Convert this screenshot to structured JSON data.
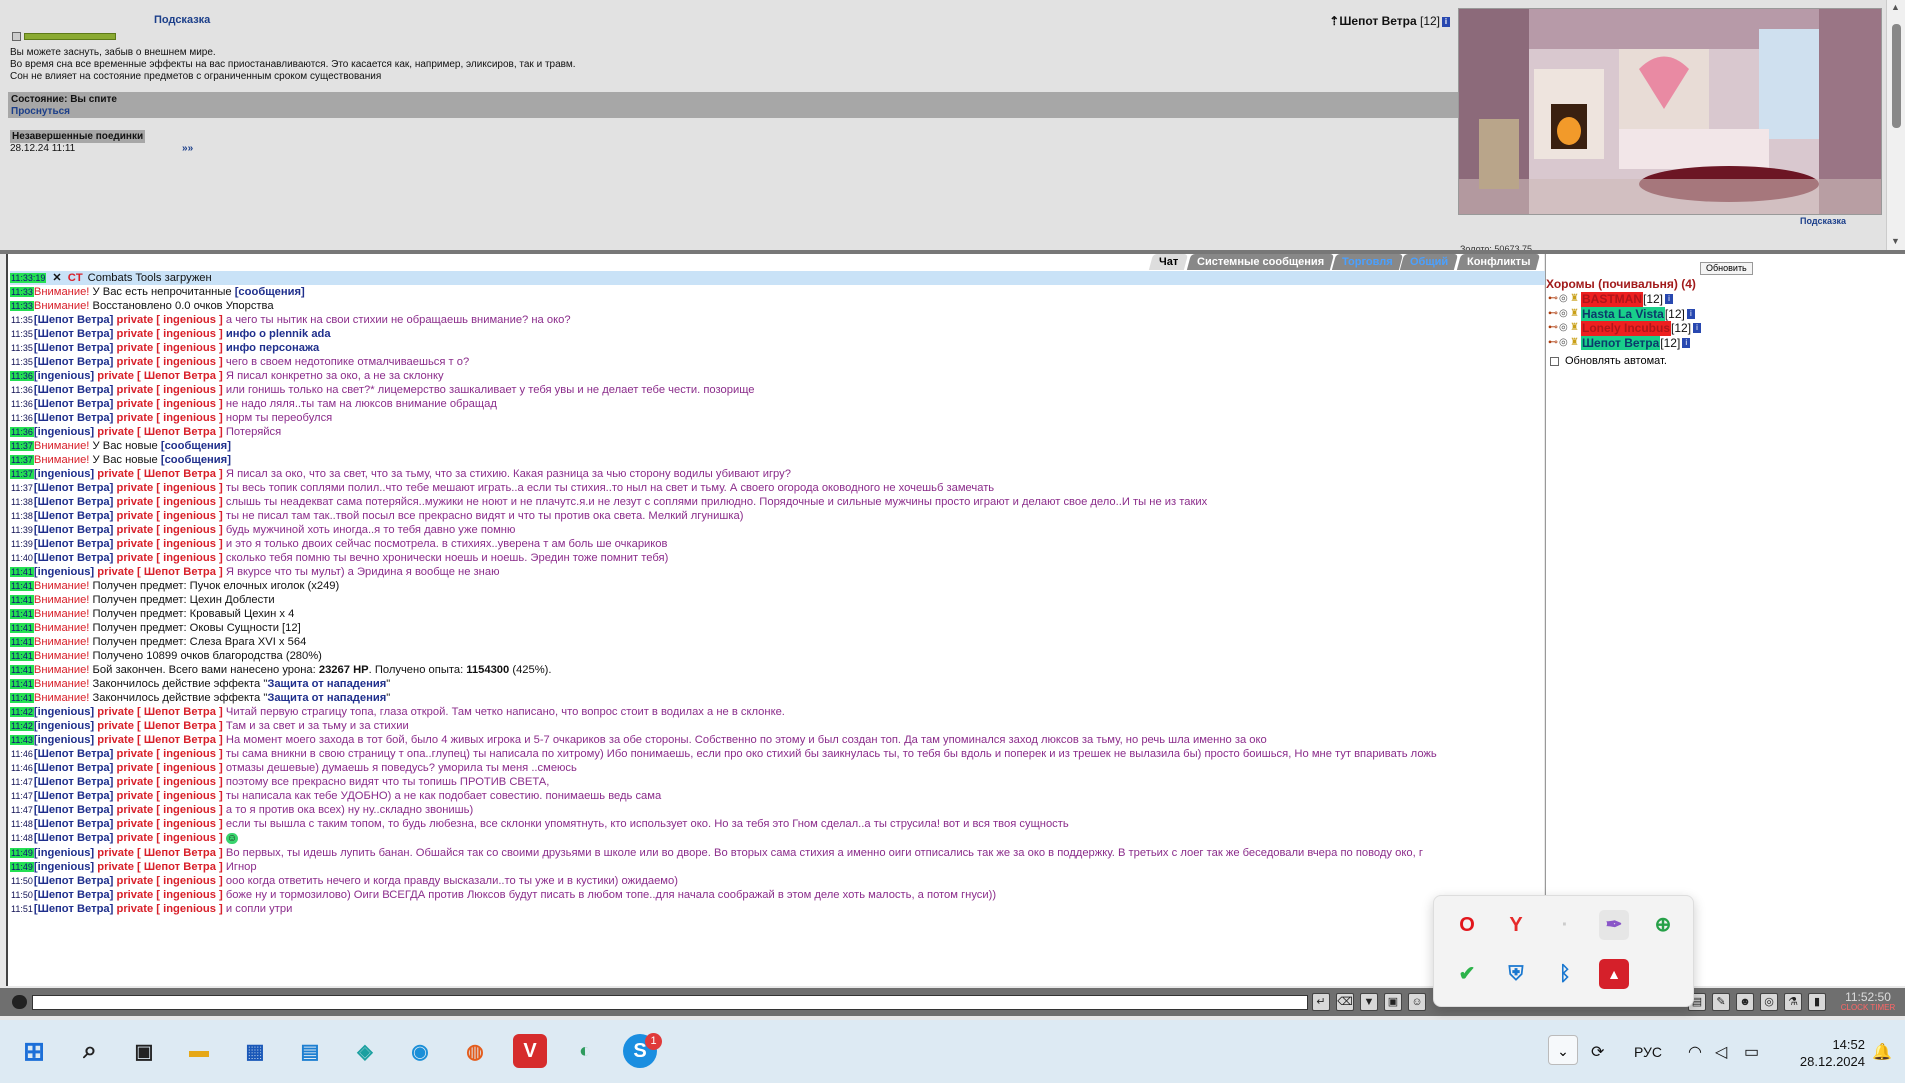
{
  "top": {
    "hint": "Подсказка",
    "player_name": "Шепот Ветра",
    "player_level": "[12]",
    "desc": [
      "Вы можете заснуть, забыв о внешнем мире.",
      "Во время сна все временные эффекты на вас приостанавливаются. Это касается как, например, эликсиров, так и травм.",
      "Сон не влияет на состояние предметов с ограниченным сроком существования"
    ],
    "state_label": "Состояние:",
    "state_value": "Вы спите",
    "wake": "Проснуться",
    "duels_title": "Незавершенные поединки",
    "duel_date": "28.12.24 11:11",
    "duel_more": "»»",
    "room_hint": "Подсказка",
    "room_cut": "Золото: 50673.75"
  },
  "chat": {
    "tabs": [
      "Чат",
      "Системные сообщения",
      "Торговля",
      "Общий",
      "Конфликты"
    ],
    "ct_time": "11:33:19",
    "ct_label": "CT",
    "ct_text": "Combats Tools загружен",
    "lines": [
      {
        "t": "11:33",
        "g": true,
        "k": "warn",
        "warn": "Внимание!",
        "text": " У Вас есть непрочитанные ",
        "bold": "[сообщения]"
      },
      {
        "t": "11:33",
        "g": true,
        "k": "warn",
        "warn": "Внимание!",
        "text": " Восстановлено 0.0 очков Упорства"
      },
      {
        "t": "11:35",
        "g": false,
        "k": "pm",
        "from": "[Шепот Ветра]",
        "to": "private [ ingenious ]",
        "text": "а чего ты нытик на свои стихии не обращаешь внимание? на око?"
      },
      {
        "t": "11:35",
        "g": false,
        "k": "pm",
        "from": "[Шепот Ветра]",
        "to": "private [ ingenious ]",
        "text": "",
        "bold": "инфо о plennik ada"
      },
      {
        "t": "11:35",
        "g": false,
        "k": "pm",
        "from": "[Шепот Ветра]",
        "to": "private [ ingenious ]",
        "text": "",
        "bold": "инфо персонажа"
      },
      {
        "t": "11:35",
        "g": false,
        "k": "pm",
        "from": "[Шепот Ветра]",
        "to": "private [ ingenious ]",
        "text": "чего в своем недотопике отмалчиваешься т о?"
      },
      {
        "t": "11:36",
        "g": true,
        "k": "pm",
        "from": "[ingenious]",
        "to": "private [ Шепот Ветра ]",
        "text": "Я писал конкретно за око, а не за склонку"
      },
      {
        "t": "11:36",
        "g": false,
        "k": "pm",
        "from": "[Шепот Ветра]",
        "to": "private [ ingenious ]",
        "text": "или гонишь только на свет?* лицемерство зашкаливает у тебя увы и не делает тебе чести. позорище"
      },
      {
        "t": "11:36",
        "g": false,
        "k": "pm",
        "from": "[Шепот Ветра]",
        "to": "private [ ingenious ]",
        "text": "не надо ляля..ты там на люксов внимание обращад"
      },
      {
        "t": "11:36",
        "g": false,
        "k": "pm",
        "from": "[Шепот Ветра]",
        "to": "private [ ingenious ]",
        "text": "норм ты переобулся"
      },
      {
        "t": "11:36",
        "g": true,
        "k": "pm",
        "from": "[ingenious]",
        "to": "private [ Шепот Ветра ]",
        "text": "Потеряйся"
      },
      {
        "t": "11:37",
        "g": true,
        "k": "warn",
        "warn": "Внимание!",
        "text": " У Вас новые ",
        "bold": "[сообщения]"
      },
      {
        "t": "11:37",
        "g": true,
        "k": "warn",
        "warn": "Внимание!",
        "text": " У Вас новые ",
        "bold": "[сообщения]"
      },
      {
        "t": "11:37",
        "g": true,
        "k": "pm",
        "from": "[ingenious]",
        "to": "private [ Шепот Ветра ]",
        "text": "Я писал за око, что за свет, что за тьму, что за стихию. Какая разница за чью сторону водилы убивают игру?"
      },
      {
        "t": "11:37",
        "g": false,
        "k": "pm",
        "from": "[Шепот Ветра]",
        "to": "private [ ingenious ]",
        "text": "ты весь топик соплями полил..что тебе мешают играть..а если ты стихия..то ныл на свет и тьму. А своего огорода оководного не хочешьб замечать"
      },
      {
        "t": "11:38",
        "g": false,
        "k": "pm",
        "from": "[Шепот Ветра]",
        "to": "private [ ingenious ]",
        "text": "слышь ты неадекват сама потеряйся..мужики не ноют и не плачутс.я.и не лезут с соплями прилюдно. Порядочные и сильные мужчины просто играют и делают свое дело..И ты не из таких"
      },
      {
        "t": "11:38",
        "g": false,
        "k": "pm",
        "from": "[Шепот Ветра]",
        "to": "private [ ingenious ]",
        "text": "ты не писал там так..твой посыл все прекрасно видят и что ты против ока света. Мелкий лгунишка)"
      },
      {
        "t": "11:39",
        "g": false,
        "k": "pm",
        "from": "[Шепот Ветра]",
        "to": "private [ ingenious ]",
        "text": "будь мужчиной хоть иногда..я то тебя давно уже помню"
      },
      {
        "t": "11:39",
        "g": false,
        "k": "pm",
        "from": "[Шепот Ветра]",
        "to": "private [ ingenious ]",
        "text": "и это я только двоих сейчас посмотрела. в стихиях..уверена т ам боль ше очкариков"
      },
      {
        "t": "11:40",
        "g": false,
        "k": "pm",
        "from": "[Шепот Ветра]",
        "to": "private [ ingenious ]",
        "text": "сколько тебя помню ты вечно хронически ноешь и ноешь. Эредин тоже помнит тебя)"
      },
      {
        "t": "11:41",
        "g": true,
        "k": "pm",
        "from": "[ingenious]",
        "to": "private [ Шепот Ветра ]",
        "text": "Я вкурсе что ты мульт) а Эридина я вообще не знаю"
      },
      {
        "t": "11:41",
        "g": true,
        "k": "warn",
        "warn": "Внимание!",
        "text": " Получен предмет: Пучок елочных иголок (x249)"
      },
      {
        "t": "11:41",
        "g": true,
        "k": "warn",
        "warn": "Внимание!",
        "text": " Получен предмет: Цехин Доблести"
      },
      {
        "t": "11:41",
        "g": true,
        "k": "warn",
        "warn": "Внимание!",
        "text": " Получен предмет: Кровавый Цехин x 4"
      },
      {
        "t": "11:41",
        "g": true,
        "k": "warn",
        "warn": "Внимание!",
        "text": " Получен предмет: Оковы Сущности [12]"
      },
      {
        "t": "11:41",
        "g": true,
        "k": "warn",
        "warn": "Внимание!",
        "text": " Получен предмет: Слеза Врага XVI x 564"
      },
      {
        "t": "11:41",
        "g": true,
        "k": "warn",
        "warn": "Внимание!",
        "text": " Получено 10899 очков благородства (280%)"
      },
      {
        "t": "11:41",
        "g": true,
        "k": "battle",
        "warn": "Внимание!",
        "text": " Бой закончен. Всего вами нанесено урона: ",
        "b1": "23267 HP",
        "mid": ". Получено опыта: ",
        "b2": "1154300",
        "end": " (425%)."
      },
      {
        "t": "11:41",
        "g": true,
        "k": "warn",
        "warn": "Внимание!",
        "text": " Закончилось действие эффекта \"",
        "bold": "Защита от нападения",
        "end": "\""
      },
      {
        "t": "11:41",
        "g": true,
        "k": "warn",
        "warn": "Внимание!",
        "text": " Закончилось действие эффекта \"",
        "bold": "Защита от нападения",
        "end": "\""
      },
      {
        "t": "11:42",
        "g": true,
        "k": "pm",
        "from": "[ingenious]",
        "to": "private [ Шепот Ветра ]",
        "text": "Читай первую страгицу топа, глаза открой. Там четко написано, что вопрос стоит в водилах а не в склонке."
      },
      {
        "t": "11:42",
        "g": true,
        "k": "pm",
        "from": "[ingenious]",
        "to": "private [ Шепот Ветра ]",
        "text": "Там и за свет и за тьму и за стихии"
      },
      {
        "t": "11:43",
        "g": true,
        "k": "pm",
        "from": "[ingenious]",
        "to": "private [ Шепот Ветра ]",
        "text": "На момент моего захода в тот бой, было 4 живых игрока и 5-7 очкариков за обе стороны. Собственно по этому и был создан топ. Да там упоминался заход люксов за тьму, но речь шла именно за око"
      },
      {
        "t": "11:46",
        "g": false,
        "k": "pm",
        "wrap": true,
        "from": "[Шепот Ветра]",
        "to": "private [ ingenious ]",
        "text": "ты сама вникни в свою страницу т опа..глупец) ты написала по хитрому) Ибо понимаешь, если про око стихий бы заикнулась ты, то тебя бы вдоль и поперек и из трешек не вылазила бы) просто боишься, Но мне тут впаривать ложь"
      },
      {
        "t": "11:46",
        "g": false,
        "k": "pm",
        "from": "[Шепот Ветра]",
        "to": "private [ ingenious ]",
        "text": "отмазы дешевые) думаешь я поведусь? уморила ты меня ..смеюсь"
      },
      {
        "t": "11:47",
        "g": false,
        "k": "pm",
        "from": "[Шепот Ветра]",
        "to": "private [ ingenious ]",
        "text": "поэтому все прекрасно видят что ты топишь ПРОТИВ СВЕТА,"
      },
      {
        "t": "11:47",
        "g": false,
        "k": "pm",
        "from": "[Шепот Ветра]",
        "to": "private [ ingenious ]",
        "text": "ты написала как тебе УДОБНО) а не как подобает совестию. понимаешь ведь сама"
      },
      {
        "t": "11:47",
        "g": false,
        "k": "pm",
        "from": "[Шепот Ветра]",
        "to": "private [ ingenious ]",
        "text": "а то я против ока всех) ну ну..складно звонишь)"
      },
      {
        "t": "11:48",
        "g": false,
        "k": "pm",
        "from": "[Шепот Ветра]",
        "to": "private [ ingenious ]",
        "text": "если ты вышла с таким топом, то будь любезна, все склонки упомятнуть, кто использует око. Но за тебя это Гном сделал..а ты струсила! вот и вся твоя сущность"
      },
      {
        "t": "11:48",
        "g": false,
        "k": "pm",
        "from": "[Шепот Ветра]",
        "to": "private [ ingenious ]",
        "text": "",
        "smile": true
      },
      {
        "t": "11:49",
        "g": true,
        "k": "pm",
        "wrap": true,
        "from": "[ingenious]",
        "to": "private [ Шепот Ветра ]",
        "text": "Во первых, ты идешь лупить банан. Обшайся так со своими друзьями в школе или во дворе. Во вторых сама стихия а именно оиги отписались так же за око в поддержку. В третьих с лоег так же беседовали вчера по поводу око, г"
      },
      {
        "t": "11:49",
        "g": true,
        "k": "pm",
        "from": "[ingenious]",
        "to": "private [ Шепот Ветра ]",
        "text": "Игнор"
      },
      {
        "t": "11:50",
        "g": false,
        "k": "pm",
        "from": "[Шепот Ветра]",
        "to": "private [ ingenious ]",
        "text": "ооо когда ответить нечего и когда правду высказали..то ты уже и в кустики) ожидаемо)"
      },
      {
        "t": "11:50",
        "g": false,
        "k": "pm",
        "from": "[Шепот Ветра]",
        "to": "private [ ingenious ]",
        "text": "боже ну и тормозилово) Оиги ВСЕГДА против Люксов будут писать в любом топе..для начала соображай в этом деле хоть малость, а потом гнуси))"
      },
      {
        "t": "11:51",
        "g": false,
        "k": "pm",
        "from": "[Шепот Ветра]",
        "to": "private [ ingenious ]",
        "text": "и сопли утри"
      }
    ]
  },
  "room": {
    "refresh": "Обновить",
    "title": "Хоромы (почивальня) (4)",
    "users": [
      {
        "name": "BASTMAN",
        "level": "[12]",
        "style": "red"
      },
      {
        "name": "Hasta La Vista",
        "level": "[12]",
        "style": "green"
      },
      {
        "name": "Lonely Incubus",
        "level": "[12]",
        "style": "red"
      },
      {
        "name": "Шепот Ветра",
        "level": "[12]",
        "style": "green"
      }
    ],
    "auto_refresh": "Обновлять автомат."
  },
  "game_clock": {
    "time": "11:52:50",
    "label": "CLOCK TIMER"
  },
  "taskbar": {
    "badge": "1",
    "lang": "РУС",
    "time": "14:52",
    "date": "28.12.2024"
  },
  "colors": {
    "accent_green": "#23e052",
    "private_red": "#d8202a",
    "nick_blue": "#1f2f8c",
    "pm_purple": "#8b2d8b"
  }
}
